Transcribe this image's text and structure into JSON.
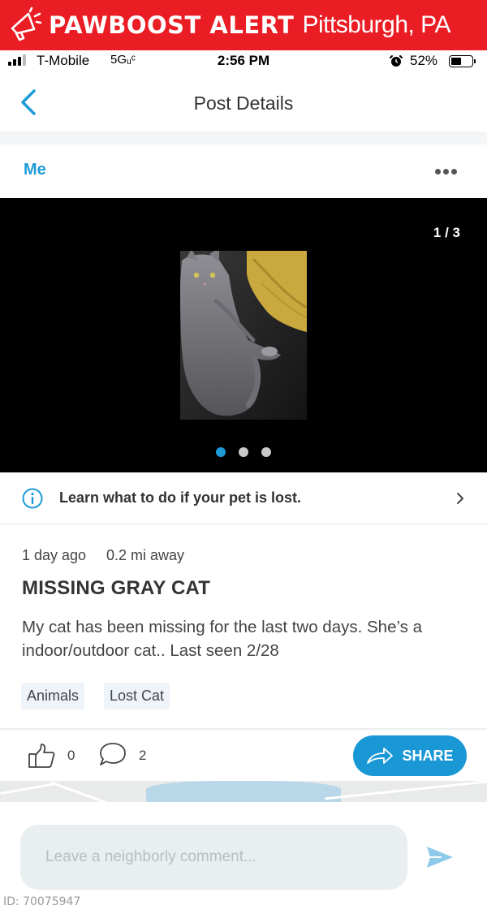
{
  "alert": {
    "brand": "PAWBOOST ALERT",
    "location": "Pittsburgh, PA",
    "icon": "megaphone-icon"
  },
  "status_bar": {
    "carrier": "T-Mobile",
    "network": "5Gᵤᶜ",
    "time": "2:56 PM",
    "battery_pct": "52%",
    "battery_level": 0.52
  },
  "nav": {
    "title": "Post Details",
    "back_icon": "chevron-left-icon"
  },
  "author": {
    "name": "Me",
    "more_icon": "ellipsis-icon"
  },
  "gallery": {
    "counter": "1 / 3",
    "current_index": 0,
    "total": 3
  },
  "info": {
    "text": "Learn what to do if your pet is lost.",
    "icon": "info-icon"
  },
  "post": {
    "time_ago": "1 day ago",
    "distance": "0.2 mi away",
    "title": "MISSING GRAY CAT",
    "body": "My cat has been missing for the last two days. She’s a indoor/outdoor cat.. Last seen 2/28",
    "tags": [
      "Animals",
      "Lost Cat"
    ]
  },
  "actions": {
    "like_count": "0",
    "comment_count": "2",
    "share_label": "SHARE"
  },
  "comment": {
    "placeholder": "Leave a neighborly comment..."
  },
  "footer": {
    "image_id": "ID: 70075947"
  },
  "colors": {
    "alert_red": "#ea1c24",
    "accent_blue": "#1e9bd7",
    "share_blue": "#1a98d5"
  }
}
